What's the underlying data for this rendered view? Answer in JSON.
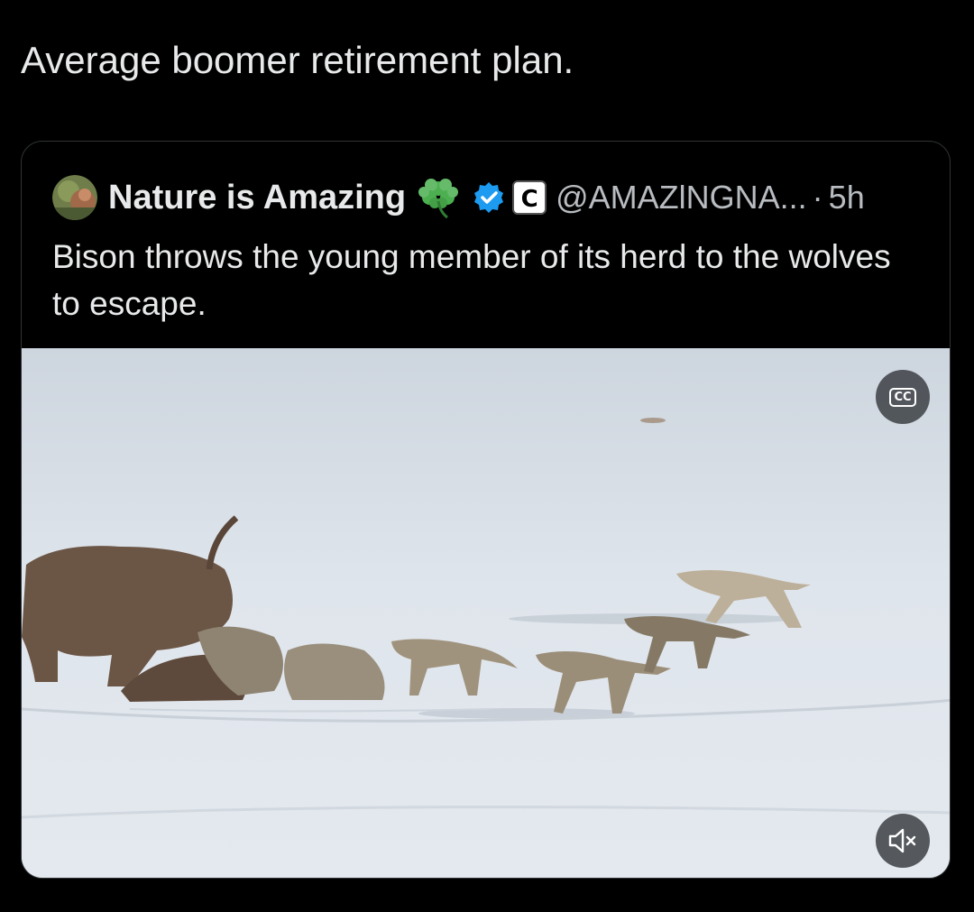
{
  "post": {
    "text": "Average boomer retirement plan."
  },
  "quoted_post": {
    "author_name": "Nature is Amazing",
    "name_emoji_icon": "shamrock-icon",
    "verified_icon": "verified-badge-icon",
    "affiliate_badge_label": "C",
    "handle": "@AMAZlNGNA...",
    "separator": "·",
    "timestamp": "5h",
    "text": "Bison throws the young member of its herd to the wolves to escape.",
    "media": {
      "type": "video",
      "captions_button": "CC",
      "mute_icon": "volume-muted-icon"
    }
  },
  "colors": {
    "background": "#000000",
    "text_primary": "#e7e9ea",
    "text_secondary": "#b8bcc0",
    "verified_blue": "#1d9bf0",
    "card_border": "#2f3336"
  }
}
